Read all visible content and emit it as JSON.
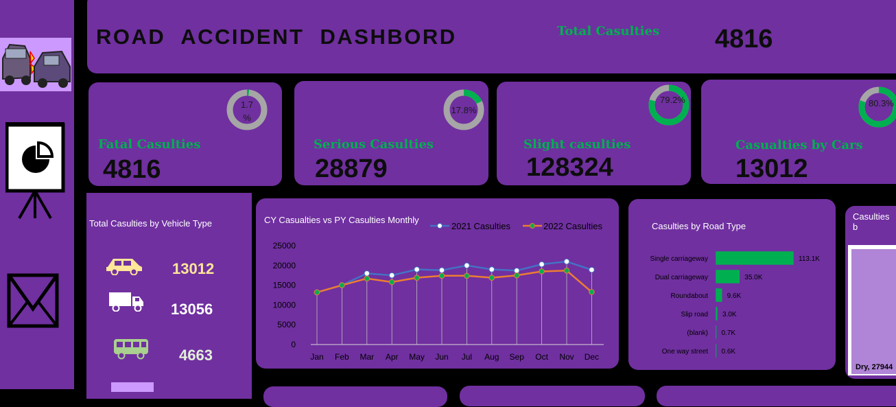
{
  "header": {
    "title": "ROAD  ACCIDENT  DASHBORD",
    "total_label": "Total Casulties",
    "total_value": "4816"
  },
  "kpis": [
    {
      "label": "Fatal Casulties",
      "value": "4816",
      "pct_text": "1.7 %",
      "pct": 1.7
    },
    {
      "label": "Serious Casulties",
      "value": "28879",
      "pct_text": "17.8%",
      "pct": 17.8
    },
    {
      "label": "Slight casulties",
      "value": "128324",
      "pct_text": "79.2%",
      "pct": 79.2
    },
    {
      "label": "Casualties by Cars",
      "value": "13012",
      "pct_text": "80.3%",
      "pct": 80.3
    }
  ],
  "vehicle_panel": {
    "title": "Total Casulties by Vehicle Type",
    "items": [
      {
        "icon": "car-icon",
        "value": "13012",
        "color": "#ffe699"
      },
      {
        "icon": "truck-icon",
        "value": "13056",
        "color": "#ffffff"
      },
      {
        "icon": "bus-icon",
        "value": "4663",
        "color": "#e2efda"
      }
    ]
  },
  "road_panel": {
    "title": "Casulties by Road Type"
  },
  "surface_panel": {
    "title": "Casulties b",
    "label": "Dry, 27944"
  },
  "colors": {
    "panel": "#7030a0",
    "green": "#00b050",
    "series_2021": "#4472c4",
    "series_2022": "#ed7d31",
    "donut_track": "#a6a6a6"
  },
  "chart_data": [
    {
      "type": "line",
      "title": "CY Casualties vs PY Casulties Monthly",
      "categories": [
        "Jan",
        "Feb",
        "Mar",
        "Apr",
        "May",
        "Jun",
        "Jul",
        "Aug",
        "Sep",
        "Oct",
        "Nov",
        "Dec"
      ],
      "series": [
        {
          "name": "2021 Casulties",
          "values": [
            13200,
            15000,
            18000,
            17500,
            19000,
            18800,
            20000,
            19000,
            18700,
            20300,
            21000,
            18900
          ]
        },
        {
          "name": "2022 Casulties",
          "values": [
            13200,
            15000,
            16700,
            15800,
            16900,
            17400,
            17400,
            16900,
            17500,
            18500,
            18700,
            13300
          ]
        }
      ],
      "yticks": [
        "25000",
        "20000",
        "15000",
        "10000",
        "5000",
        "0"
      ],
      "ylim": [
        0,
        25000
      ],
      "legend": "top"
    },
    {
      "type": "bar",
      "title": "Casulties by Road Type",
      "categories": [
        "Single carriageway",
        "Dual carriageway",
        "Roundabout",
        "Slip road",
        "(blank)",
        "One way street"
      ],
      "values": [
        113.1,
        35.0,
        9.6,
        3.0,
        0.7,
        0.6
      ],
      "labels": [
        "113.1K",
        "35.0K",
        "9.6K",
        "3.0K",
        "0.7K",
        "0.6K"
      ]
    }
  ]
}
